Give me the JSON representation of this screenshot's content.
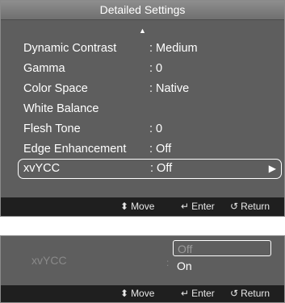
{
  "top_panel": {
    "title": "Detailed Settings",
    "scroll_up_icon": "triangle-up-icon",
    "items": [
      {
        "label": "Dynamic Contrast",
        "value": ": Medium"
      },
      {
        "label": "Gamma",
        "value": ": 0"
      },
      {
        "label": "Color Space",
        "value": ": Native"
      },
      {
        "label": "White Balance",
        "value": ""
      },
      {
        "label": "Flesh Tone",
        "value": ": 0"
      },
      {
        "label": "Edge Enhancement",
        "value": ": Off"
      },
      {
        "label": "xvYCC",
        "value": ": Off",
        "selected": true
      }
    ],
    "selected_arrow_icon": "triangle-right-icon",
    "help": {
      "move_icon": "up-down-arrows-icon",
      "move": "Move",
      "enter_icon": "enter-icon",
      "enter": "Enter",
      "return_icon": "return-icon",
      "return": "Return"
    }
  },
  "bottom_panel": {
    "label": "xvYCC",
    "colon": ":",
    "options": [
      "Off",
      "On"
    ],
    "current_option": "Off",
    "help": {
      "move": "Move",
      "enter": "Enter",
      "return": "Return"
    }
  },
  "colors": {
    "panel_bg": "#5e5e5e",
    "help_bar_bg": "#1f1f1f",
    "text": "#ffffff",
    "dimmed_text": "#8a8a8a"
  }
}
